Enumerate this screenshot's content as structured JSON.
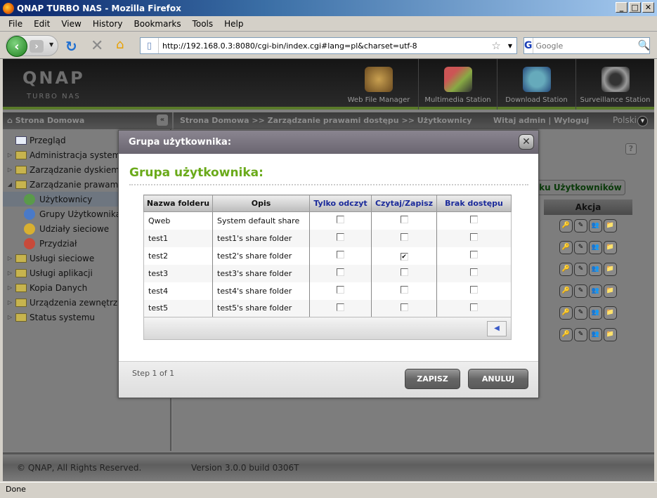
{
  "window": {
    "title": "QNAP TURBO NAS - Mozilla Firefox",
    "controls": [
      "minimize",
      "maximize",
      "close"
    ]
  },
  "menubar": [
    "File",
    "Edit",
    "View",
    "History",
    "Bookmarks",
    "Tools",
    "Help"
  ],
  "toolbar": {
    "url": "http://192.168.0.3:8080/cgi-bin/index.cgi#lang=pl&charset=utf-8",
    "search_placeholder": "Google",
    "search_engine": "G"
  },
  "header": {
    "logo": "QNAP",
    "logo_sub": "TURBO NAS",
    "apps": [
      {
        "label": "Web File Manager",
        "icon": "folder-search-icon"
      },
      {
        "label": "Multimedia Station",
        "icon": "multimedia-icon"
      },
      {
        "label": "Download Station",
        "icon": "download-icon"
      },
      {
        "label": "Surveillance Station",
        "icon": "camera-icon"
      }
    ]
  },
  "subbar": {
    "home": "Strona Domowa",
    "breadcrumb": "Strona Domowa >> Zarządzanie prawami dostępu >> Użytkownicy",
    "welcome": "Witaj admin | Wyloguj",
    "language": "Polski"
  },
  "sidebar": {
    "items": [
      {
        "label": "Przegląd",
        "type": "leaf"
      },
      {
        "label": "Administracja systemu",
        "type": "folder"
      },
      {
        "label": "Zarządzanie dyskiem",
        "type": "folder"
      },
      {
        "label": "Zarządzanie prawami dostępu",
        "type": "folder-open"
      },
      {
        "label": "Użytkownicy",
        "type": "child",
        "selected": true
      },
      {
        "label": "Grupy Użytkownika",
        "type": "child"
      },
      {
        "label": "Udziały sieciowe",
        "type": "child"
      },
      {
        "label": "Przydział",
        "type": "child"
      },
      {
        "label": "Usługi sieciowe",
        "type": "folder"
      },
      {
        "label": "Usługi aplikacji",
        "type": "folder"
      },
      {
        "label": "Kopia Danych",
        "type": "folder"
      },
      {
        "label": "Urządzenia zewnętrzne",
        "type": "folder"
      },
      {
        "label": "Status systemu",
        "type": "folder"
      }
    ]
  },
  "background": {
    "tab_button": "lku Użytkowników",
    "action_header": "Akcja",
    "action_rows": 6
  },
  "dialog": {
    "title": "Grupa użytkownika:",
    "heading": "Grupa użytkownika:",
    "columns": [
      "Nazwa folderu",
      "Opis",
      "Tylko odczyt",
      "Czytaj/Zapisz",
      "Brak dostępu"
    ],
    "rows": [
      {
        "name": "Qweb",
        "desc": "System default share",
        "ro": false,
        "rw": false,
        "na": false
      },
      {
        "name": "test1",
        "desc": "test1's share folder",
        "ro": false,
        "rw": false,
        "na": false
      },
      {
        "name": "test2",
        "desc": "test2's share folder",
        "ro": false,
        "rw": true,
        "na": false
      },
      {
        "name": "test3",
        "desc": "test3's share folder",
        "ro": false,
        "rw": false,
        "na": false
      },
      {
        "name": "test4",
        "desc": "test4's share folder",
        "ro": false,
        "rw": false,
        "na": false
      },
      {
        "name": "test5",
        "desc": "test5's share folder",
        "ro": false,
        "rw": false,
        "na": false
      }
    ],
    "step": "Step 1 of 1",
    "save": "ZAPISZ",
    "cancel": "ANULUJ"
  },
  "footer": {
    "copyright": "© QNAP, All Rights Reserved.",
    "version": "Version 3.0.0 build 0306T"
  },
  "status": "Done"
}
